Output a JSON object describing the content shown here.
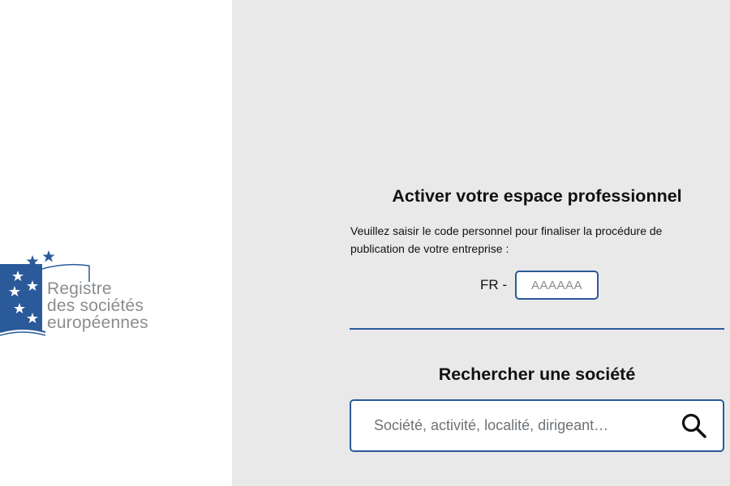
{
  "logo": {
    "line1": "Registre",
    "line2": "des sociétés",
    "line3": "européennes",
    "brand_color": "#2a5a9a",
    "text_color": "#8a8d90"
  },
  "activate": {
    "title": "Activer votre espace professionnel",
    "instructions": "Veuillez saisir le code personnel pour finaliser la procédure de publication de votre entreprise :",
    "code_prefix": "FR -",
    "code_placeholder": "AAAAAA",
    "code_value": ""
  },
  "search": {
    "title": "Rechercher une société",
    "placeholder": "Société, activité, localité, dirigeant…",
    "value": "",
    "button_icon": "search-icon"
  },
  "colors": {
    "accent": "#2a5a9a",
    "right_background": "#e9e9e9",
    "left_background": "#ffffff"
  }
}
